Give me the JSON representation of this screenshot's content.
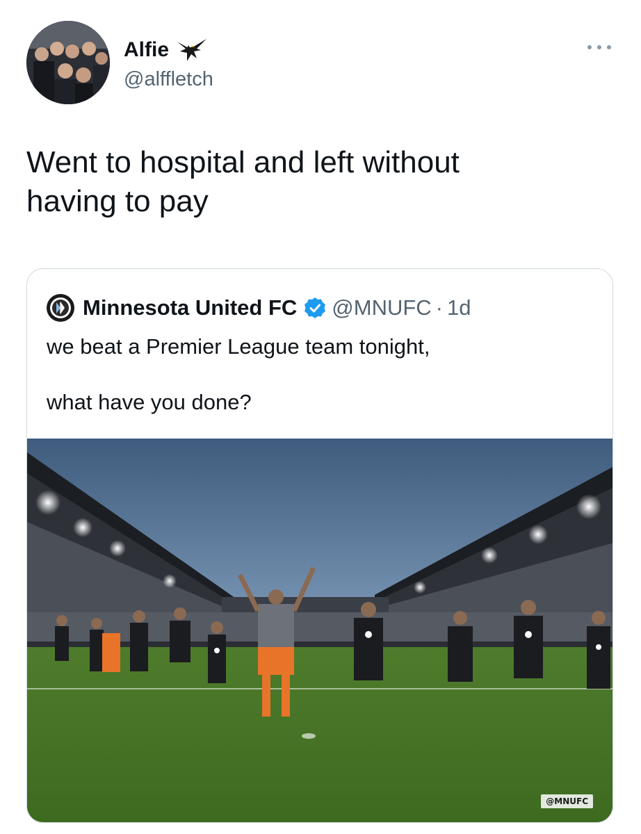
{
  "author": {
    "display_name": "Alfie",
    "handle": "@alffletch",
    "badge_icon": "eagle-icon"
  },
  "tweet": {
    "text": "Went to hospital and left without\nhaving to pay"
  },
  "quoted": {
    "display_name": "Minnesota United FC",
    "verified": true,
    "handle": "@MNUFC",
    "separator": "·",
    "time": "1d",
    "text": "we beat a Premier League team tonight,\n\nwhat have you done?",
    "media": {
      "description_icon": "stadium-photo",
      "watermark": "@MNUFC"
    }
  },
  "colors": {
    "verified_blue": "#1d9bf0",
    "secondary_text": "#536471",
    "border": "#cfd9de"
  }
}
